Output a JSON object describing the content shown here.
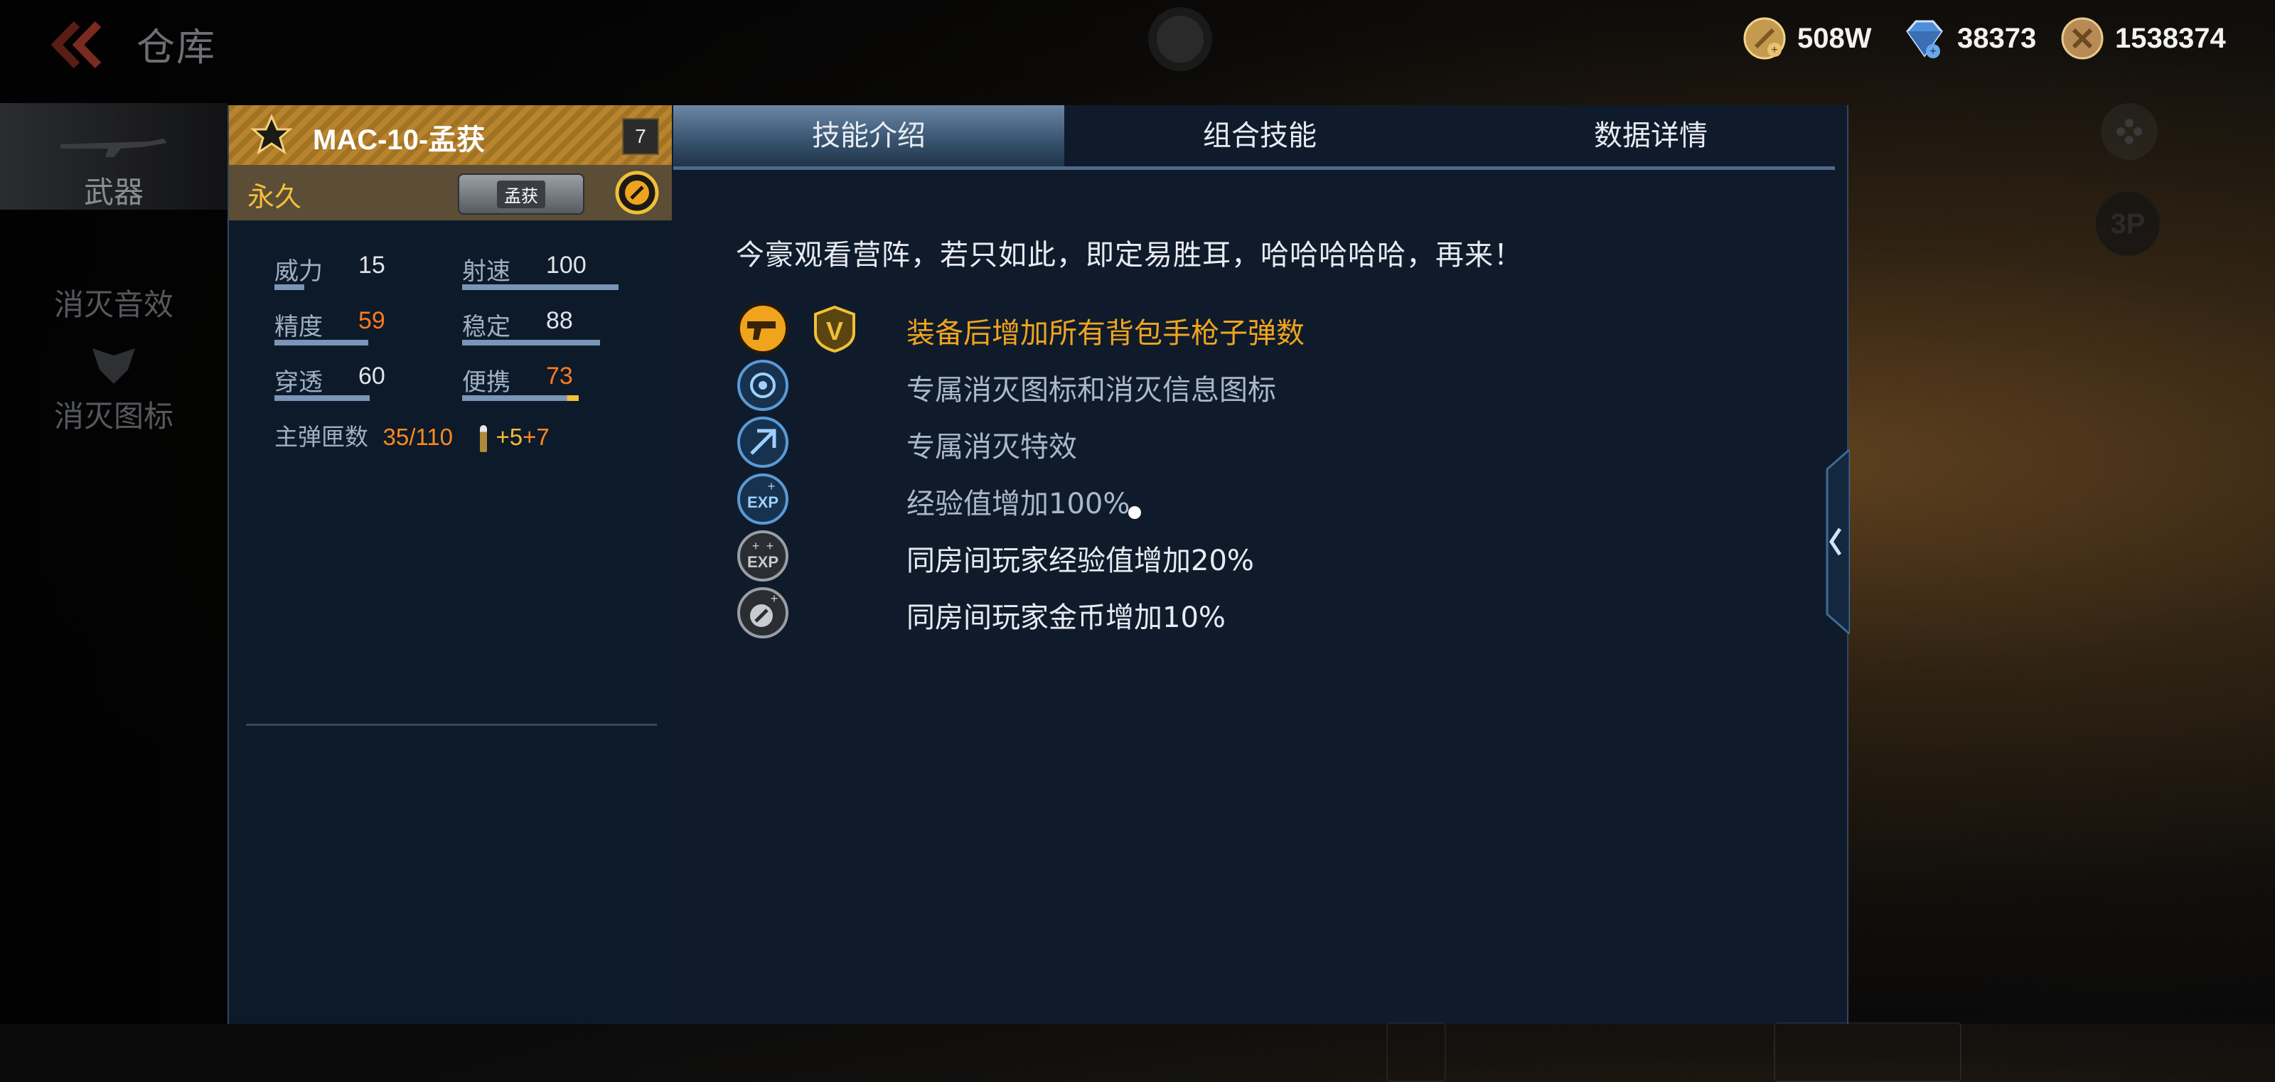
{
  "header": {
    "title": "仓库",
    "currencies": [
      {
        "icon": "gold-coin-icon",
        "value": "508W"
      },
      {
        "icon": "diamond-icon",
        "value": "38373"
      },
      {
        "icon": "medal-coin-icon",
        "value": "1538374"
      }
    ]
  },
  "sidebar": {
    "items": [
      {
        "label": "武器",
        "active": true
      },
      {
        "label": "消灭音效",
        "active": false
      },
      {
        "label": "消灭图标",
        "active": false
      }
    ]
  },
  "weapon": {
    "name": "MAC-10-孟获",
    "level": "7",
    "duration": "永久",
    "badge": "孟获",
    "stats": [
      {
        "name": "威力",
        "value": "15",
        "highlight": false,
        "level": 15
      },
      {
        "name": "射速",
        "value": "100",
        "highlight": false,
        "level": 100
      },
      {
        "name": "精度",
        "value": "59",
        "highlight": true,
        "level": 59
      },
      {
        "name": "稳定",
        "value": "88",
        "highlight": false,
        "level": 88
      },
      {
        "name": "穿透",
        "value": "60",
        "highlight": false,
        "level": 60
      },
      {
        "name": "便携",
        "value": "73",
        "highlight": true,
        "level": 73
      }
    ],
    "ammo_label": "主弹匣数",
    "ammo_value": "35/110",
    "ammo_bonus_a": "+5",
    "ammo_bonus_b": "+7"
  },
  "skills": {
    "tabs": [
      "技能介绍",
      "组合技能",
      "数据详情"
    ],
    "active_tab": 0,
    "quote": "今豪观看营阵，若只如此，即定易胜耳，哈哈哈哈哈，再来！",
    "items": [
      {
        "icon": "pistol-icon",
        "text": "装备后增加所有背包手枪子弹数"
      },
      {
        "icon": "kill-icon-badge",
        "text": "专属消灭图标和消灭信息图标"
      },
      {
        "icon": "kill-effect-icon",
        "text": "专属消灭特效"
      },
      {
        "icon": "exp-icon",
        "text": "经验值增加100%"
      },
      {
        "icon": "room-exp-icon",
        "text": "同房间玩家经验值增加20%"
      },
      {
        "icon": "room-gold-icon",
        "text": "同房间玩家金币增加10%"
      }
    ],
    "vip_label": "V"
  },
  "right_controls": {
    "view_toggle": "3P"
  },
  "colors": {
    "gold": "#f0a41e",
    "orange": "#ff7a1e",
    "panel": "#0f1b2b",
    "bar": "#7a95b7"
  }
}
